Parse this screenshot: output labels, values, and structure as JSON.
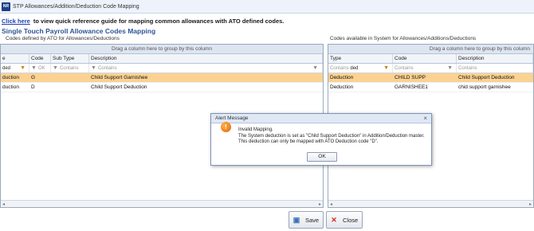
{
  "window": {
    "title": "STP Allowances/Addition/Deduction Code Mapping",
    "icon_text": "NR"
  },
  "linkbar": {
    "link_text": "Click here",
    "rest_text": "to view quick reference guide for mapping common allowances with ATO defined codes."
  },
  "subtitle": "Single Touch Payroll Allowance Codes Mapping",
  "left_panel": {
    "caption": "Codes defined by ATO for Allowances/Deductions",
    "group_hint": "Drag a column here to group by this column",
    "columns": [
      "e",
      "Code",
      "Sub Type",
      "Description"
    ],
    "filters": {
      "type_value": "ded",
      "code_value": "OK",
      "subtype_placeholder": "Contains",
      "desc_placeholder": "Contains"
    },
    "rows": [
      {
        "type": "duction",
        "code": "G",
        "subtype": "",
        "description": "Child Support Garnishee",
        "selected": true
      },
      {
        "type": "duction",
        "code": "D",
        "subtype": "",
        "description": "Child Support Deduction",
        "selected": false
      }
    ]
  },
  "right_panel": {
    "caption": "Codes available in System for Allowances/Additions/Deductions",
    "group_hint": "Drag a column here to group by this column",
    "columns": [
      "Type",
      "Code",
      "Description"
    ],
    "filters": {
      "type_placeholder": "Contains",
      "type_value": "ded",
      "code_placeholder": "Contains",
      "desc_placeholder": "Contains"
    },
    "rows": [
      {
        "type": "Deduction",
        "code": "CHILD SUPP",
        "description": "Child Support Deduction",
        "selected": true
      },
      {
        "type": "Deduction",
        "code": "GARNISHEE1",
        "description": "chid support garnishee",
        "selected": false
      }
    ]
  },
  "buttons": {
    "save": "Save",
    "close": "Close"
  },
  "dialog": {
    "title": "Alert Message",
    "close_glyph": "×",
    "line1": "Invalid Mapping.",
    "line2": "The System deduction is set as \"Child Support Deduction\" in Addition/Deduction master.",
    "line3": "This deduction can only be mapped with ATO Deduction code \"D\".",
    "ok_label": "OK",
    "icon_glyph": "!"
  },
  "colors": {
    "selected_row": "#fbd292",
    "subtitle": "#2f5597",
    "link": "#1a3fb4"
  }
}
